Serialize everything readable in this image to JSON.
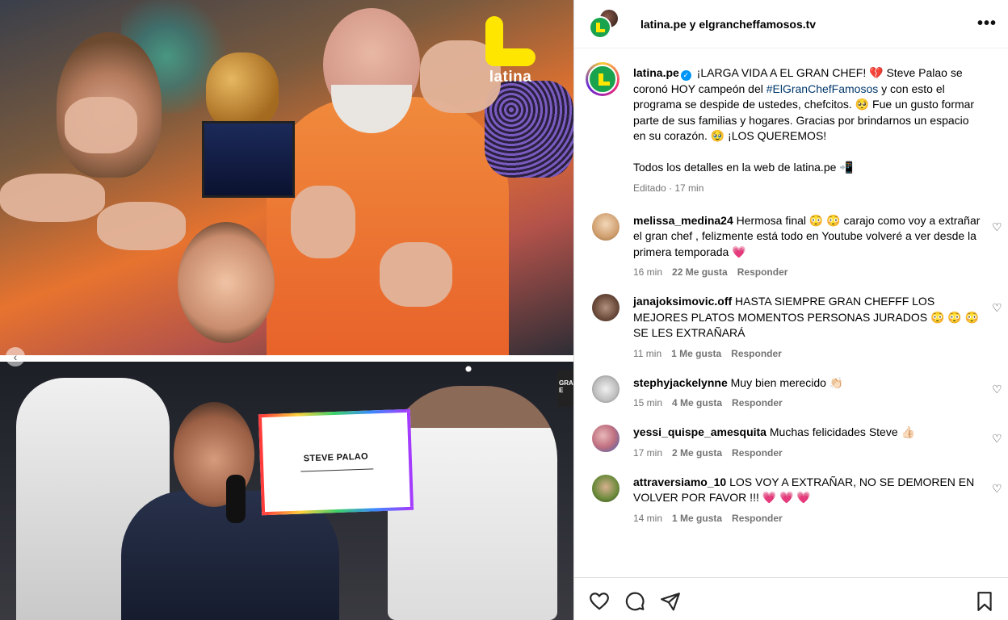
{
  "media": {
    "logo_text": "latina",
    "sign_text": "STEVE PALAO",
    "side_tag": "GRA\nE"
  },
  "header": {
    "names": "latina.pe y elgrancheffamosos.tv",
    "more_label": "•••"
  },
  "caption": {
    "username": "latina.pe",
    "part1": " ¡LARGA VIDA A EL GRAN CHEF! 💔 Steve Palao se coronó HOY campeón del ",
    "hashtag": "#ElGranChefFamosos",
    "part2": " y con esto el programa se despide de ustedes, chefcitos. 🥺 Fue un gusto formar parte de sus familias y hogares. Gracias por brindarnos un espacio en su corazón. 🥹 ¡LOS QUEREMOS!",
    "part3": "Todos los detalles en la web de latina.pe 📲",
    "edited": "Editado",
    "time": "17 min"
  },
  "comments": [
    {
      "username": "melissa_medina24",
      "text": " Hermosa final 😳 😳 carajo como voy a extrañar el gran chef , felizmente está todo en Youtube volveré a ver desde la primera temporada 💗",
      "time": "16 min",
      "likes": "22 Me gusta",
      "reply": "Responder",
      "avatar_color": "#e8c9a0"
    },
    {
      "username": "janajoksimovic.off",
      "text": " HASTA SIEMPRE GRAN CHEFFF LOS MEJORES PLATOS MOMENTOS PERSONAS JURADOS 😳 😳 😳 SE LES EXTRAÑARÁ",
      "time": "11 min",
      "likes": "1 Me gusta",
      "reply": "Responder",
      "avatar_color": "#8a6a5a"
    },
    {
      "username": "stephyjackelynne",
      "text": " Muy bien merecido 👏🏻",
      "time": "15 min",
      "likes": "4 Me gusta",
      "reply": "Responder",
      "avatar_color": "#cfcfcf"
    },
    {
      "username": "yessi_quispe_amesquita",
      "text": " Muchas felicidades Steve 👍🏻",
      "time": "17 min",
      "likes": "2 Me gusta",
      "reply": "Responder",
      "avatar_color": "#c8a0a8"
    },
    {
      "username": "attraversiamo_10",
      "text": " LOS VOY A EXTRAÑAR, NO SE DEMOREN EN VOLVER POR FAVOR !!! 💗 💗 💗",
      "time": "14 min",
      "likes": "1 Me gusta",
      "reply": "Responder",
      "avatar_color": "#6a8a3a"
    }
  ],
  "colors": {
    "brand_green": "#19a34d",
    "brand_yellow": "#ffe600",
    "link": "#00376b",
    "muted": "#737373"
  },
  "icons": {
    "like": "heart-icon",
    "comment": "comment-icon",
    "share": "send-icon",
    "save": "bookmark-icon"
  }
}
